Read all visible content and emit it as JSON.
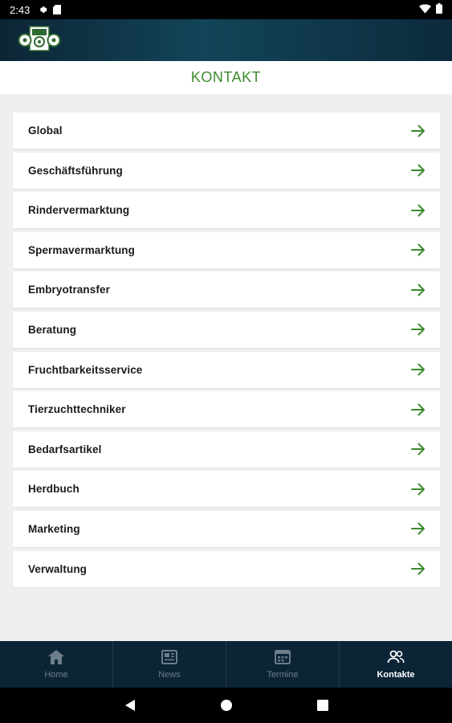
{
  "status_bar": {
    "time": "2:43",
    "icons": [
      "settings-icon",
      "sd-card-icon",
      "wifi-icon",
      "battery-icon"
    ]
  },
  "header": {
    "logo_icon": "association-logo-icon"
  },
  "page": {
    "title": "KONTAKT",
    "accent_color": "#3b8a2c"
  },
  "list": {
    "items": [
      {
        "label": "Global"
      },
      {
        "label": "Geschäftsführung"
      },
      {
        "label": "Rindervermarktung"
      },
      {
        "label": "Spermavermarktung"
      },
      {
        "label": "Embryotransfer"
      },
      {
        "label": "Beratung"
      },
      {
        "label": "Fruchtbarkeitsservice"
      },
      {
        "label": "Tierzuchttechniker"
      },
      {
        "label": "Bedarfsartikel"
      },
      {
        "label": "Herdbuch"
      },
      {
        "label": "Marketing"
      },
      {
        "label": "Verwaltung"
      }
    ],
    "arrow_icon": "arrow-right-icon"
  },
  "bottom_nav": {
    "items": [
      {
        "label": "Home",
        "icon": "home-icon",
        "active": false
      },
      {
        "label": "News",
        "icon": "news-icon",
        "active": false
      },
      {
        "label": "Termine",
        "icon": "calendar-icon",
        "active": false
      },
      {
        "label": "Kontakte",
        "icon": "contacts-icon",
        "active": true
      }
    ]
  },
  "system_nav": {
    "buttons": [
      "back-icon",
      "home-circle-icon",
      "recents-icon"
    ]
  }
}
